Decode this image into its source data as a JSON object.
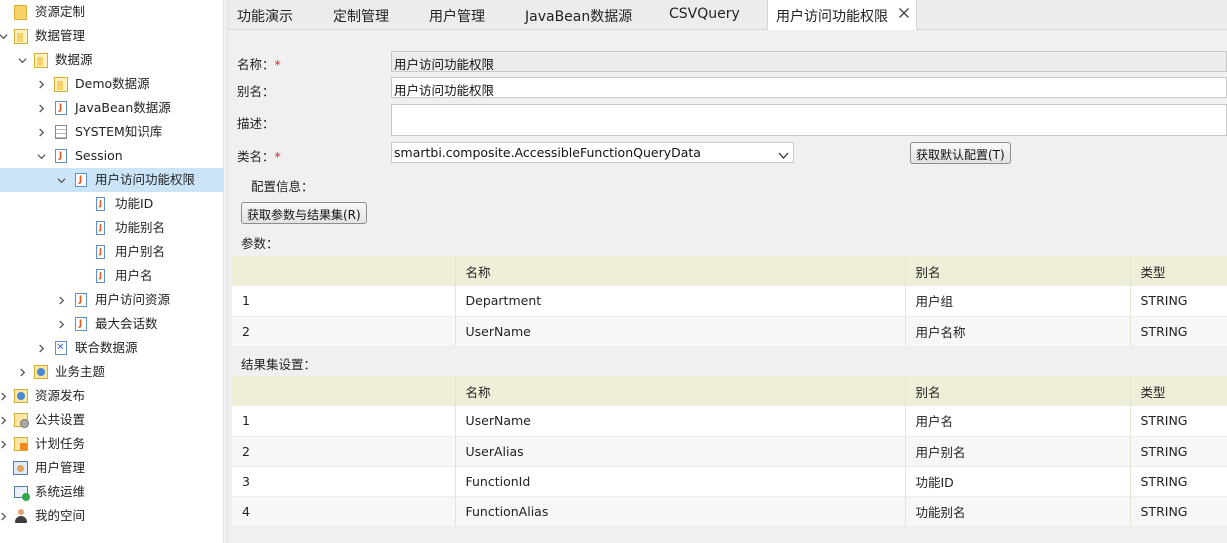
{
  "sidebar": {
    "items": [
      {
        "label": "资源定制",
        "icon": "folder-icon"
      },
      {
        "label": "数据管理",
        "icon": "folder-open-icon"
      },
      {
        "label": "数据源",
        "icon": "folder-open-icon"
      },
      {
        "label": "Demo数据源",
        "icon": "folder-open-icon"
      },
      {
        "label": "JavaBean数据源",
        "icon": "javabean-icon"
      },
      {
        "label": "SYSTEM知识库",
        "icon": "database-icon"
      },
      {
        "label": "Session",
        "icon": "javabean-icon"
      },
      {
        "label": "用户访问功能权限",
        "icon": "javabean-icon"
      },
      {
        "label": "功能ID",
        "icon": "field-icon"
      },
      {
        "label": "功能别名",
        "icon": "field-icon"
      },
      {
        "label": "用户别名",
        "icon": "field-icon"
      },
      {
        "label": "用户名",
        "icon": "field-icon"
      },
      {
        "label": "用户访问资源",
        "icon": "javabean-icon"
      },
      {
        "label": "最大会话数",
        "icon": "javabean-icon"
      },
      {
        "label": "联合数据源",
        "icon": "composite-datasource-icon"
      },
      {
        "label": "业务主题",
        "icon": "business-theme-icon"
      },
      {
        "label": "资源发布",
        "icon": "publish-icon"
      },
      {
        "label": "公共设置",
        "icon": "settings-icon"
      },
      {
        "label": "计划任务",
        "icon": "schedule-icon"
      },
      {
        "label": "用户管理",
        "icon": "user-management-icon"
      },
      {
        "label": "系统运维",
        "icon": "system-ops-icon"
      },
      {
        "label": "我的空间",
        "icon": "user-icon"
      }
    ]
  },
  "tabs": [
    {
      "label": "功能演示"
    },
    {
      "label": "定制管理"
    },
    {
      "label": "用户管理"
    },
    {
      "label": "JavaBean数据源"
    },
    {
      "label": "CSVQuery"
    },
    {
      "label": "用户访问功能权限",
      "active": true
    }
  ],
  "form": {
    "name_label": "名称：",
    "name_value": "用户访问功能权限",
    "alias_label": "别名：",
    "alias_value": "用户访问功能权限",
    "desc_label": "描述：",
    "desc_value": "",
    "class_label": "类名：",
    "class_value": "smartbi.composite.AccessibleFunctionQueryData",
    "required_mark": "*",
    "default_config_button": "获取默认配置(T)",
    "config_info_label": "配置信息：",
    "fetch_params_button": "获取参数与结果集(R)",
    "params_label": "参数：",
    "resultset_label": "结果集设置："
  },
  "params_table": {
    "headers": [
      "",
      "名称",
      "别名",
      "类型"
    ],
    "rows": [
      [
        "1",
        "Department",
        "用户组",
        "STRING"
      ],
      [
        "2",
        "UserName",
        "用户名称",
        "STRING"
      ]
    ]
  },
  "result_table": {
    "headers": [
      "",
      "名称",
      "别名",
      "类型"
    ],
    "rows": [
      [
        "1",
        "UserName",
        "用户名",
        "STRING"
      ],
      [
        "2",
        "UserAlias",
        "用户别名",
        "STRING"
      ],
      [
        "3",
        "FunctionId",
        "功能ID",
        "STRING"
      ],
      [
        "4",
        "FunctionAlias",
        "功能别名",
        "STRING"
      ]
    ]
  },
  "colors": {
    "selected_row": "#cce4f7",
    "table_header": "#efefd9",
    "required": "#d9262c",
    "panel_bg": "#f0f0f0"
  }
}
